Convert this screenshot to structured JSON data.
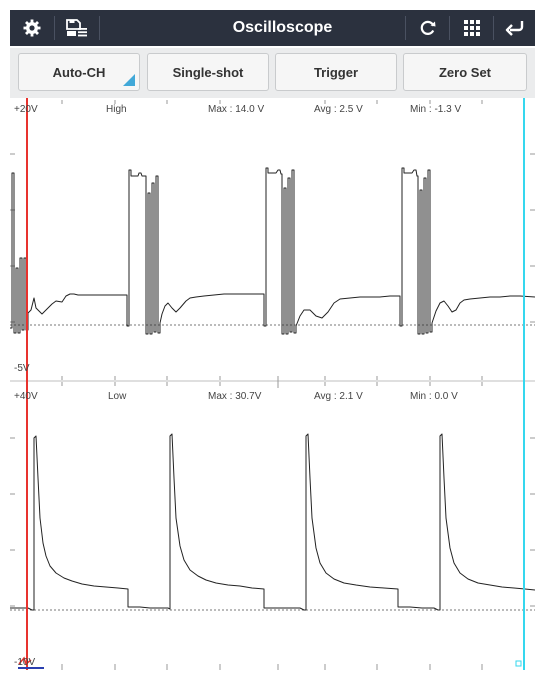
{
  "toolbar": {
    "title": "Oscilloscope",
    "icons": [
      "gear-icon",
      "save-list-icon",
      "refresh-icon",
      "grid-icon",
      "back-icon"
    ],
    "bg_color": "#2b313e"
  },
  "buttons": {
    "auto_ch": "Auto-CH",
    "single_shot": "Single-shot",
    "trigger": "Trigger",
    "zero_set": "Zero Set"
  },
  "channel_high": {
    "top_scale": "+20V",
    "bottom_scale": "-5V",
    "name": "High",
    "max": "Max : 14.0 V",
    "avg": "Avg : 2.5 V",
    "min": "Min : -1.3 V"
  },
  "channel_low": {
    "top_scale": "+40V",
    "bottom_scale": "-10V",
    "name": "Low",
    "max": "Max : 30.7V",
    "avg": "Avg : 2.1 V",
    "min": "Min : 0.0 V"
  },
  "colors": {
    "cursor_left": "#e8332e",
    "cursor_right": "#35d7ee",
    "accent": "#41a8d8",
    "trace": "#222222"
  }
}
